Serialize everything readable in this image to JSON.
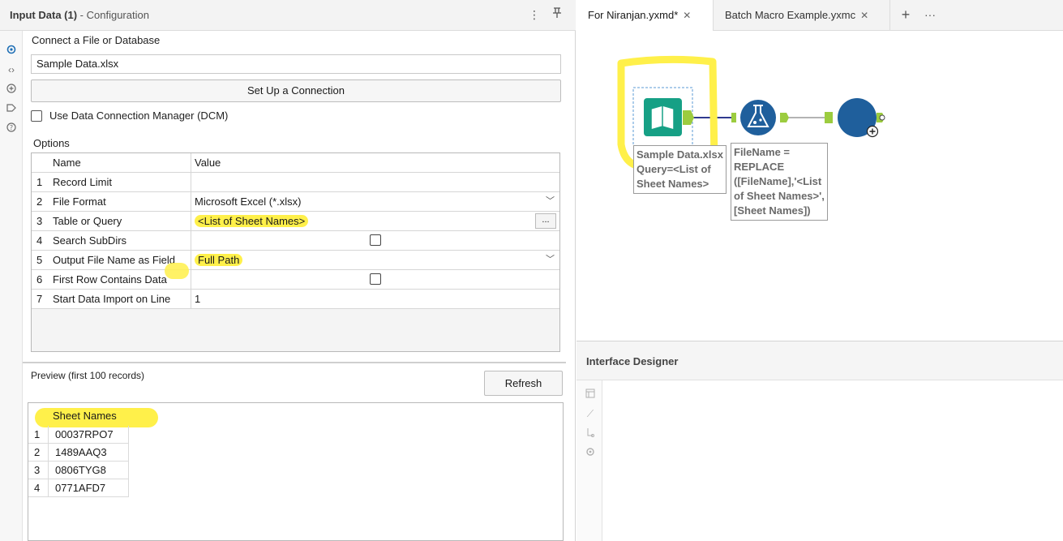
{
  "config": {
    "title": "Input Data (1)",
    "subtitle": " - Configuration",
    "connect_label": "Connect a File or Database",
    "file_value": "Sample Data.xlsx",
    "setup_button": "Set Up a Connection",
    "dcm_label": "Use Data Connection Manager (DCM)",
    "options_label": "Options",
    "grid": {
      "header_name": "Name",
      "header_value": "Value",
      "rows": [
        {
          "num": "1",
          "name": "Record Limit",
          "value": ""
        },
        {
          "num": "2",
          "name": "File Format",
          "value": "Microsoft Excel (*.xlsx)"
        },
        {
          "num": "3",
          "name": "Table or Query",
          "value": "<List of Sheet Names>"
        },
        {
          "num": "4",
          "name": "Search SubDirs",
          "value": ""
        },
        {
          "num": "5",
          "name": "Output File Name as Field",
          "value": "Full Path"
        },
        {
          "num": "6",
          "name": "First Row Contains Data",
          "value": ""
        },
        {
          "num": "7",
          "name": "Start Data Import on Line",
          "value": "1"
        }
      ],
      "browse_button": "..."
    },
    "preview_label": "Preview (first 100 records)",
    "refresh_button": "Refresh",
    "preview": {
      "column": "Sheet Names",
      "rows": [
        {
          "num": "1",
          "value": "00037RPO7"
        },
        {
          "num": "2",
          "value": "1489AAQ3"
        },
        {
          "num": "3",
          "value": "0806TYG8"
        },
        {
          "num": "4",
          "value": "0771AFD7"
        }
      ]
    }
  },
  "tabs": [
    {
      "label": "For Niranjan.yxmd*",
      "active": true
    },
    {
      "label": "Batch Macro Example.yxmc",
      "active": false
    }
  ],
  "canvas": {
    "input_caption": "Sample Data.xlsx\nQuery=<List of\nSheet Names>",
    "formula_caption": "FileName =\nREPLACE\n([FileName],'<List\nof Sheet Names>',\n[Sheet Names])"
  },
  "interface_designer": {
    "title": "Interface Designer"
  },
  "colors": {
    "highlight": "#fff04a",
    "input_tool": "#16a085",
    "formula_tool": "#1f5f9c",
    "macro_output": "#1f5f9c",
    "anchor": "#9ccc3f"
  }
}
